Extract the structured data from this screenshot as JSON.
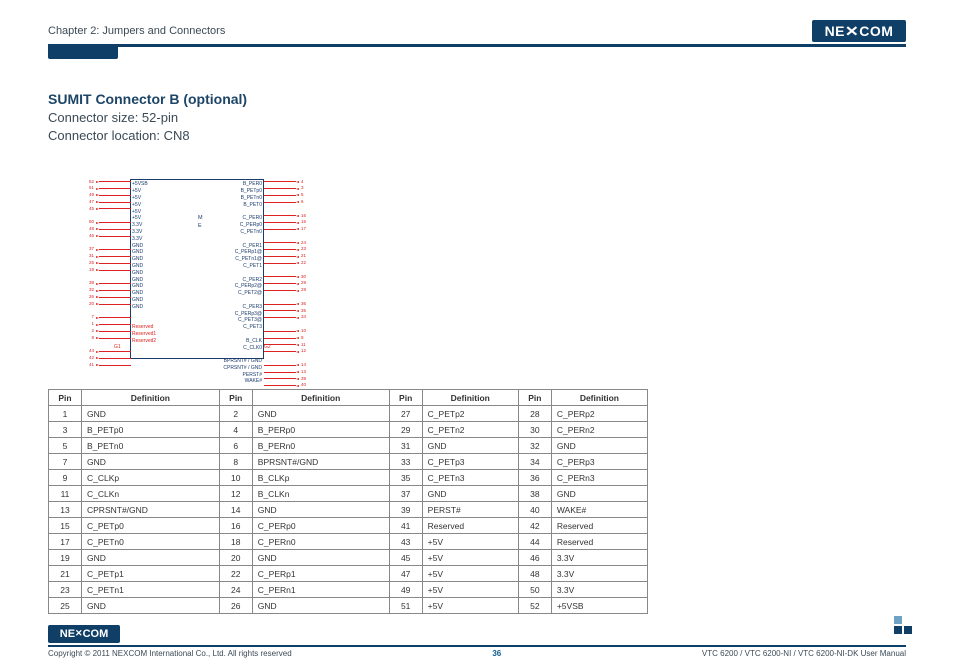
{
  "header": {
    "chapter": "Chapter 2: Jumpers and Connectors",
    "logo": "NEXCOM"
  },
  "section": {
    "title": "SUMIT Connector B (optional)",
    "size_line": "Connector size: 52-pin",
    "loc_line": "Connector location: CN8"
  },
  "diagram": {
    "block_label_top": "M",
    "block_label_bottom": "E",
    "left_labels": [
      "+5VSB",
      "+5V",
      "+5V",
      "+5V",
      "+5V",
      "+5V",
      "3.3V",
      "3.3V",
      "3.3V",
      "GND",
      "GND",
      "GND",
      "GND",
      "GND",
      "GND",
      "GND",
      "GND",
      "GND",
      "GND",
      "",
      "",
      "Reserved",
      "Reserved1",
      "Reserved2",
      "",
      ""
    ],
    "right_labels": [
      "B_PER0",
      "B_PETp0",
      "B_PETn0",
      "B_PET0",
      "",
      "C_PER0",
      "C_PERp0",
      "C_PETn0",
      "",
      "C_PER1",
      "C_PERp1@",
      "C_PETn1@",
      "C_PET1",
      "",
      "C_PER2",
      "C_PERp2@",
      "C_PET2@",
      "",
      "C_PER3",
      "C_PERp3@",
      "C_PET3@",
      "C_PET3",
      "",
      "B_CLK",
      "C_CLK0",
      "",
      "BPRSNT# / GND",
      "CPRSNT# / GND",
      "PERST#",
      "WAKE#"
    ],
    "left_pins": [
      "52",
      "51",
      "49",
      "47",
      "45",
      "",
      "50",
      "48",
      "46",
      "",
      "37",
      "31",
      "25",
      "19",
      "",
      "38",
      "32",
      "26",
      "20",
      "",
      "7",
      "1",
      "2",
      "8",
      "",
      "44",
      "42",
      "41",
      "",
      "",
      ""
    ],
    "right_pins": [
      "4",
      "3",
      "5",
      "6",
      "",
      "16",
      "15",
      "17",
      "",
      "24",
      "23",
      "21",
      "22",
      "",
      "30",
      "29",
      "28",
      "",
      "36",
      "35",
      "34",
      "",
      "10",
      "9",
      "11",
      "12",
      "",
      "14",
      "13",
      "39",
      "40"
    ],
    "g1": "G1",
    "g2": "G2"
  },
  "table": {
    "headers": [
      "Pin",
      "Definition",
      "Pin",
      "Definition",
      "Pin",
      "Definition",
      "Pin",
      "Definition"
    ],
    "rows": [
      [
        "1",
        "GND",
        "2",
        "GND",
        "27",
        "C_PETp2",
        "28",
        "C_PERp2"
      ],
      [
        "3",
        "B_PETp0",
        "4",
        "B_PERp0",
        "29",
        "C_PETn2",
        "30",
        "C_PERn2"
      ],
      [
        "5",
        "B_PETn0",
        "6",
        "B_PERn0",
        "31",
        "GND",
        "32",
        "GND"
      ],
      [
        "7",
        "GND",
        "8",
        "BPRSNT#/GND",
        "33",
        "C_PETp3",
        "34",
        "C_PERp3"
      ],
      [
        "9",
        "C_CLKp",
        "10",
        "B_CLKp",
        "35",
        "C_PETn3",
        "36",
        "C_PERn3"
      ],
      [
        "11",
        "C_CLKn",
        "12",
        "B_CLKn",
        "37",
        "GND",
        "38",
        "GND"
      ],
      [
        "13",
        "CPRSNT#/GND",
        "14",
        "GND",
        "39",
        "PERST#",
        "40",
        "WAKE#"
      ],
      [
        "15",
        "C_PETp0",
        "16",
        "C_PERp0",
        "41",
        "Reserved",
        "42",
        "Reserved"
      ],
      [
        "17",
        "C_PETn0",
        "18",
        "C_PERn0",
        "43",
        "+5V",
        "44",
        "Reserved"
      ],
      [
        "19",
        "GND",
        "20",
        "GND",
        "45",
        "+5V",
        "46",
        "3.3V"
      ],
      [
        "21",
        "C_PETp1",
        "22",
        "C_PERp1",
        "47",
        "+5V",
        "48",
        "3.3V"
      ],
      [
        "23",
        "C_PETn1",
        "24",
        "C_PERn1",
        "49",
        "+5V",
        "50",
        "3.3V"
      ],
      [
        "25",
        "GND",
        "26",
        "GND",
        "51",
        "+5V",
        "52",
        "+5VSB"
      ]
    ]
  },
  "footer": {
    "logo": "NEXCOM",
    "copyright": "Copyright © 2011 NEXCOM International Co., Ltd. All rights reserved",
    "page": "36",
    "manual": "VTC 6200 / VTC 6200-NI / VTC 6200-NI-DK User Manual"
  }
}
